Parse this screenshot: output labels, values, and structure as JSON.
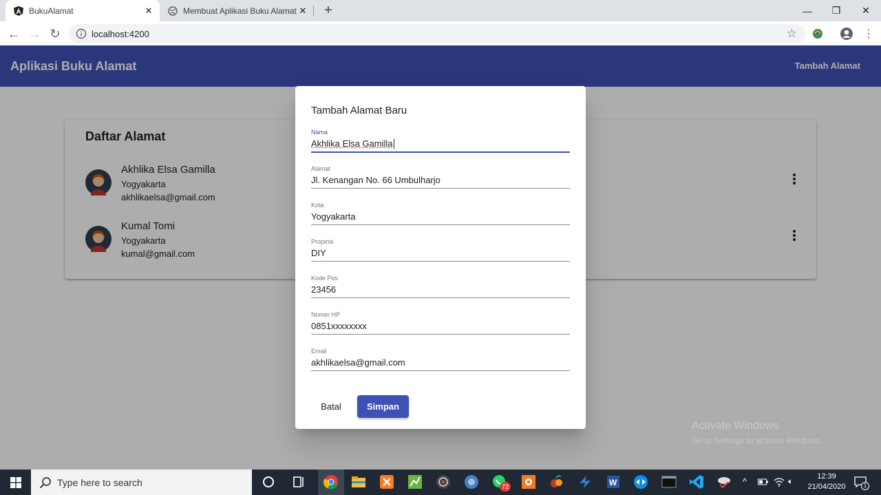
{
  "browser": {
    "tabs": [
      {
        "label": "BukuAlamat",
        "active": true
      },
      {
        "label": "Membuat Aplikasi Buku Alamat M",
        "active": false
      }
    ],
    "url": "localhost:4200"
  },
  "app": {
    "title": "Aplikasi Buku Alamat",
    "action": "Tambah Alamat",
    "accent": "#3f51b5"
  },
  "list": {
    "title": "Daftar Alamat",
    "contacts": [
      {
        "name": "Akhlika Elsa Gamilla",
        "city": "Yogyakarta",
        "email": "akhlikaelsa@gmail.com"
      },
      {
        "name": "Kumal Tomi",
        "city": "Yogyakarta",
        "email": "kumal@gmail.com"
      }
    ]
  },
  "dialog": {
    "title": "Tambah Alamat Baru",
    "fields": [
      {
        "label": "Nama",
        "value": "Akhlika Elsa Gamilla"
      },
      {
        "label": "Alamat",
        "value": "Jl. Kenangan No. 66 Umbulharjo"
      },
      {
        "label": "Kota",
        "value": "Yogyakarta"
      },
      {
        "label": "Propinsi",
        "value": "DIY"
      },
      {
        "label": "Kode Pos",
        "value": "23456"
      },
      {
        "label": "Nomer HP",
        "value": "0851xxxxxxxx"
      },
      {
        "label": "Email",
        "value": "akhlikaelsa@gmail.com"
      }
    ],
    "cancel_label": "Batal",
    "save_label": "Simpan"
  },
  "watermark": {
    "line1": "Activate Windows",
    "line2": "Go to Settings to activate Windows."
  },
  "taskbar": {
    "search_placeholder": "Type here to search",
    "whatsapp_badge": "72",
    "time": "12:39",
    "date": "21/04/2020",
    "notification_count": "1"
  }
}
